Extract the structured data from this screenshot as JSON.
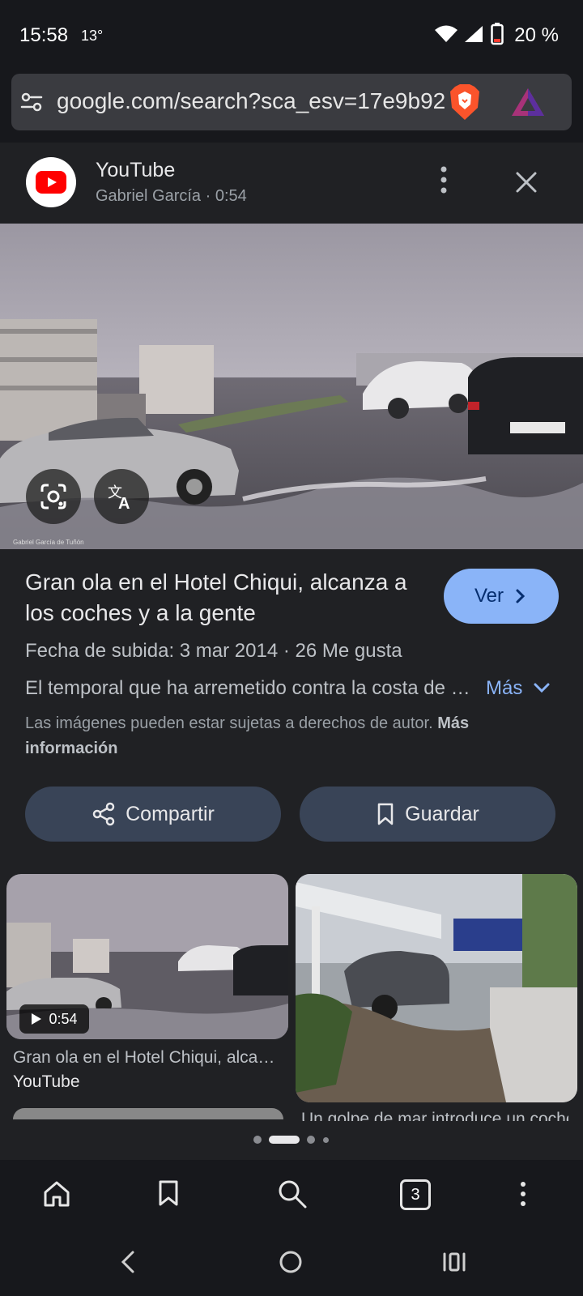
{
  "status": {
    "time": "15:58",
    "temperature": "13°",
    "battery": "20 %"
  },
  "browser": {
    "url": "google.com/search?sca_esv=17e9b92",
    "tab_count": "3"
  },
  "source": {
    "name": "YouTube",
    "meta": "Gabriel García · 0:54"
  },
  "hero": {
    "watermark": "Gabriel García de Tuñón"
  },
  "result": {
    "title": "Gran ola en el Hotel Chiqui, alcanza a los coches y a la gente",
    "view_label": "Ver",
    "meta": "Fecha de subida: 3 mar 2014  ·  26 Me gusta",
    "description": "El temporal que ha arremetido contra la costa de Gijón...",
    "more_label": "Más",
    "rights_text": "Las imágenes pueden estar sujetas a derechos de autor.",
    "rights_link": "Más información"
  },
  "actions": {
    "share_label": "Compartir",
    "save_label": "Guardar"
  },
  "related": [
    {
      "title": "Gran ola en el Hotel Chiqui, alcanza a los coches y a la gente",
      "source": "YouTube",
      "duration": "0:54"
    },
    {
      "title": "Un golpe de mar introduce un coche en el Hotel Chiqui"
    }
  ],
  "colors": {
    "accent": "#8ab4f8",
    "background": "#202124",
    "pill": "#394457",
    "youtube_red": "#ff0000"
  }
}
